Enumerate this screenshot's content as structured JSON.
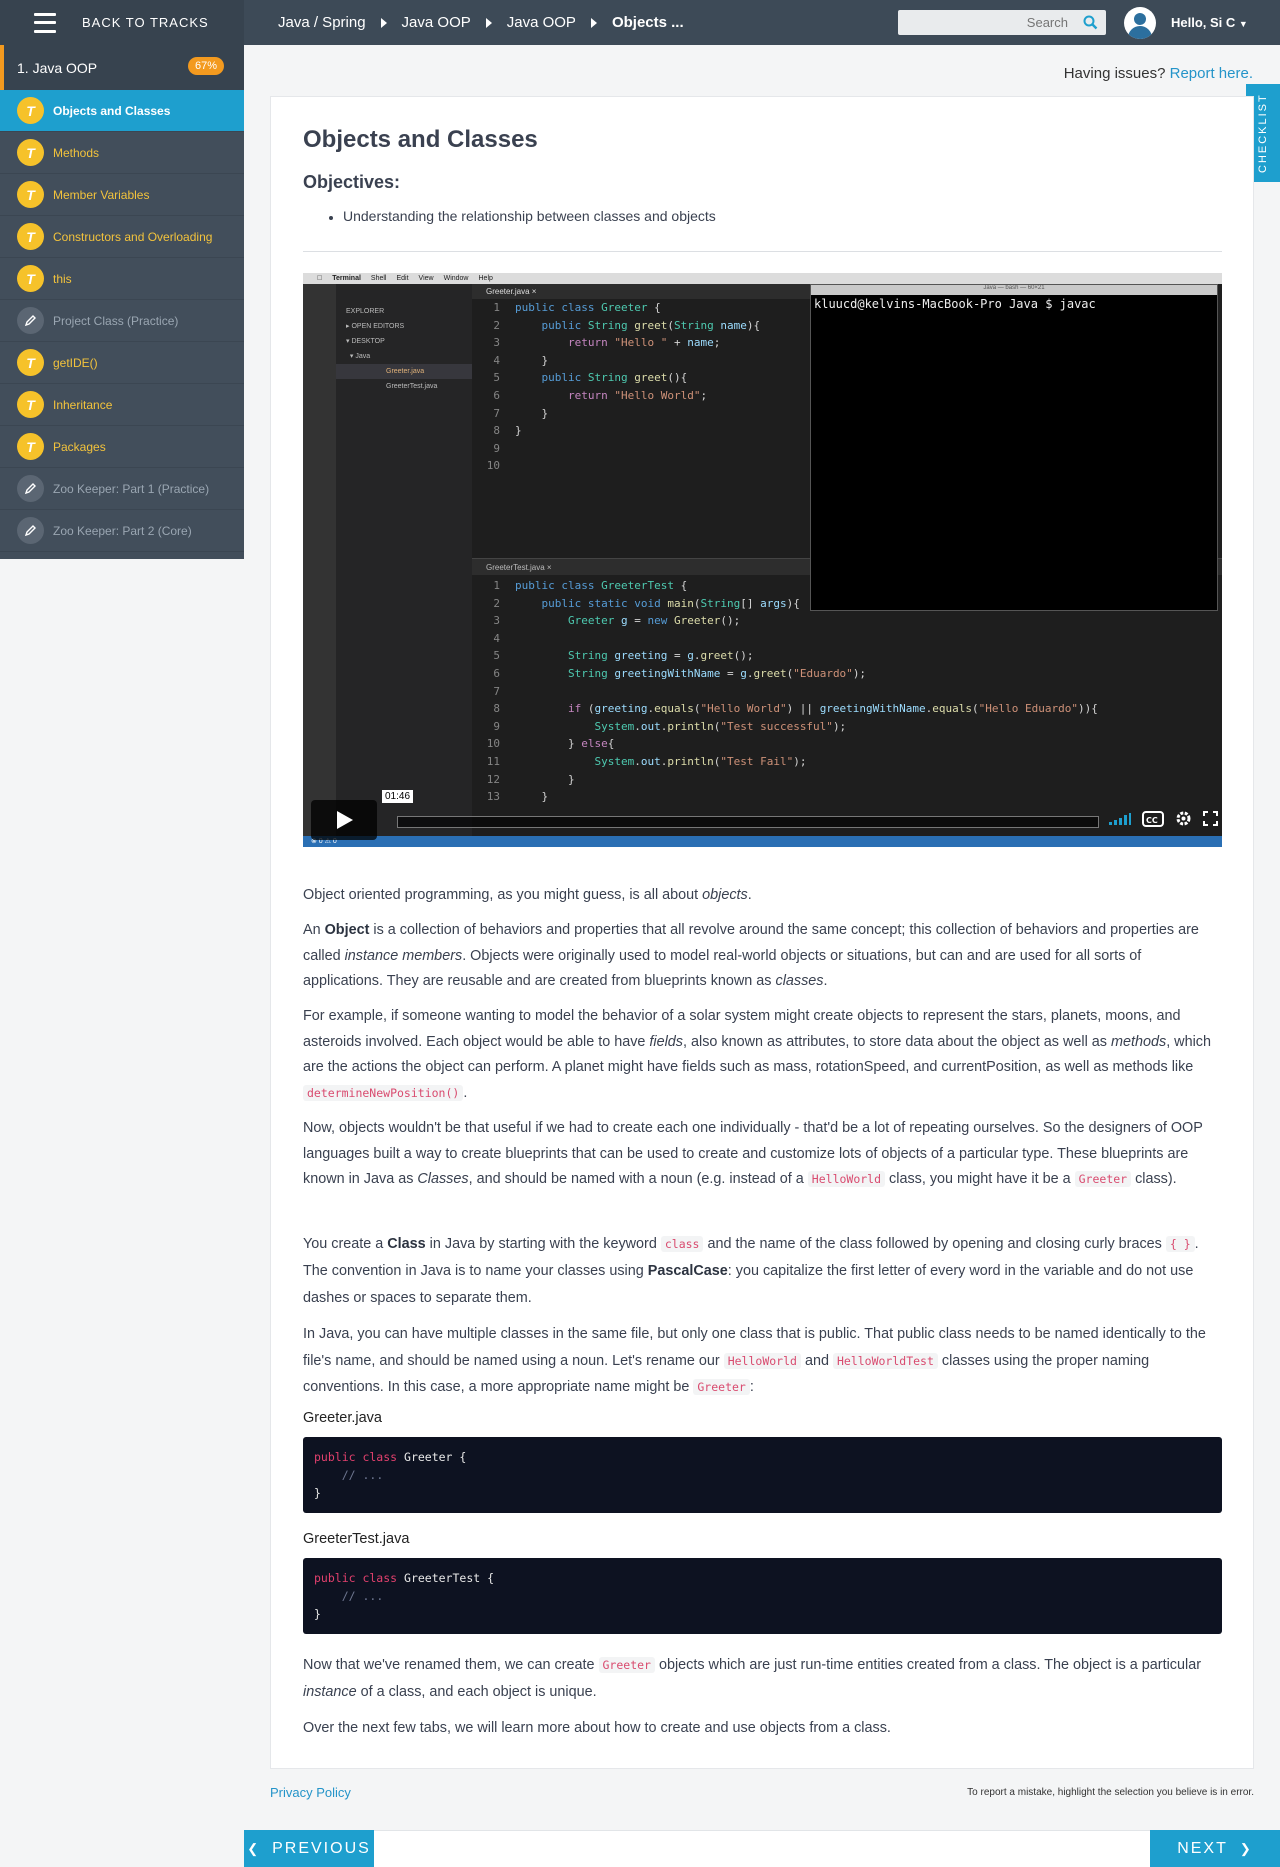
{
  "header": {
    "back_label": "BACK TO TRACKS",
    "breadcrumbs": [
      "Java / Spring",
      "Java OOP",
      "Java OOP",
      "Objects ..."
    ],
    "search_placeholder": "Search",
    "user_greeting": "Hello, Si C"
  },
  "sidebar": {
    "module_title": "1. Java OOP",
    "progress_badge": "67%",
    "items": [
      {
        "label": "Objects and Classes",
        "type": "lesson",
        "active": true
      },
      {
        "label": "Methods",
        "type": "lesson"
      },
      {
        "label": "Member Variables",
        "type": "lesson"
      },
      {
        "label": "Constructors and Overloading",
        "type": "lesson"
      },
      {
        "label": "this",
        "type": "lesson"
      },
      {
        "label": "Project Class (Practice)",
        "type": "practice"
      },
      {
        "label": "getIDE()",
        "type": "lesson"
      },
      {
        "label": "Inheritance",
        "type": "lesson"
      },
      {
        "label": "Packages",
        "type": "lesson"
      },
      {
        "label": "Zoo Keeper: Part 1 (Practice)",
        "type": "practice"
      },
      {
        "label": "Zoo Keeper: Part 2 (Core)",
        "type": "practice"
      }
    ]
  },
  "issues": {
    "text": "Having issues?",
    "link": "Report here."
  },
  "checklist_label": "CHECKLIST",
  "main": {
    "title": "Objects and Classes",
    "objectives_heading": "Objectives:",
    "objectives": [
      "Understanding the relationship between classes and objects"
    ],
    "video": {
      "time": "01:46",
      "terminal_prompt": "kluucd@kelvins-MacBook-Pro Java $ javac",
      "editor_tab1": "Greeter.java",
      "editor_tab2": "GreeterTest.java",
      "explorer_files": [
        "Greeter.java",
        "GreeterTest.java"
      ]
    },
    "p1": {
      "a": "Object oriented programming, as you might guess, is all about ",
      "b": "objects",
      "c": "."
    },
    "p2": {
      "a": "An ",
      "b": "Object",
      "c": " is a collection of behaviors and properties that all revolve around the same concept; this collection of behaviors and properties are called ",
      "d": "instance members",
      "e": ". Objects were originally used to model real-world objects or situations, but can and are used for all sorts of applications. They are reusable and are created from blueprints known as ",
      "f": "classes",
      "g": "."
    },
    "p3": {
      "a": "For example, if someone wanting to model the behavior of a solar system might create objects to represent the stars, planets, moons, and asteroids involved. Each object would be able to have ",
      "b": "fields",
      "c": ", also known as attributes, to store data about the object as well as ",
      "d": "methods",
      "e": ", which are the actions the object can perform. A planet might have fields such as mass, rotationSpeed, and currentPosition, as well as methods like ",
      "code": "determineNewPosition()",
      "f": "."
    },
    "p4": {
      "a": "Now, objects wouldn't be that useful if we had to create each one individually - that'd be a lot of repeating ourselves. So the designers of OOP languages built a way to create blueprints that can be used to create and customize lots of objects of a particular type. These blueprints are known in Java as ",
      "b": "Classes",
      "c": ", and should be named with a noun (e.g. instead of a ",
      "code1": "HelloWorld",
      "d": " class, you might have it be a ",
      "code2": "Greeter",
      "e": " class)."
    },
    "p5": {
      "a": "You create a ",
      "b": "Class",
      "c": " in Java by starting with the keyword ",
      "code1": "class",
      "d": " and the name of the class followed by opening and closing curly braces ",
      "code2": "{ }",
      "e": ". The convention in Java is to name your classes using ",
      "f": "PascalCase",
      "g": ": you capitalize the first letter of every word in the variable and do not use dashes or spaces to separate them."
    },
    "p6": {
      "a": "In Java, you can have multiple classes in the same file, but only one class that is public. That public class needs to be named identically to the file's name, and should be named using a noun. Let's rename our ",
      "code1": "HelloWorld",
      "b": " and ",
      "code2": "HelloWorldTest",
      "c": " classes using the proper naming conventions. In this case, a more appropriate name might be ",
      "code3": "Greeter",
      "d": ":"
    },
    "file1": {
      "name": "Greeter.java",
      "kw": "public class",
      "rest": " Greeter {",
      "comment": "// ...",
      "close": "}"
    },
    "file2": {
      "name": "GreeterTest.java",
      "kw": "public class",
      "rest": " GreeterTest {",
      "comment": "// ...",
      "close": "}"
    },
    "p7": {
      "a": "Now that we've renamed them, we can create ",
      "code": "Greeter",
      "b": " objects which are just run-time entities created from a class. The object is a particular ",
      "c": "instance",
      "d": " of a class, and each object is unique."
    },
    "p8": "Over the next few tabs, we will learn more about how to create and use objects from a class."
  },
  "footer": {
    "privacy": "Privacy Policy",
    "report_note": "To report a mistake, highlight the selection you believe is in error.",
    "prev": "PREVIOUS",
    "next": "NEXT"
  }
}
